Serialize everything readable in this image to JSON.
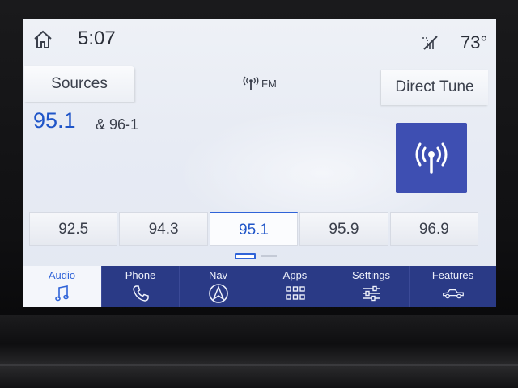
{
  "status": {
    "time": "5:07",
    "temperature": "73°"
  },
  "header": {
    "sources_label": "Sources",
    "band_label": "FM",
    "direct_tune_label": "Direct Tune"
  },
  "now_playing": {
    "frequency": "95.1",
    "station_name": "& 96-1"
  },
  "presets": [
    {
      "label": "92.5",
      "active": false
    },
    {
      "label": "94.3",
      "active": false
    },
    {
      "label": "95.1",
      "active": true
    },
    {
      "label": "95.9",
      "active": false
    },
    {
      "label": "96.9",
      "active": false
    }
  ],
  "pager": {
    "current_page": 1,
    "page_count": 2
  },
  "nav": {
    "audio": "Audio",
    "phone": "Phone",
    "nav": "Nav",
    "apps": "Apps",
    "settings": "Settings",
    "features": "Features"
  },
  "icons": {
    "home": "home-icon",
    "no_signal": "no-signal-icon",
    "antenna": "antenna-icon",
    "music_note": "music-note-icon",
    "phone": "phone-icon",
    "navigation": "navigation-icon",
    "apps_grid": "apps-grid-icon",
    "sliders": "sliders-icon",
    "vehicle": "vehicle-icon"
  },
  "colors": {
    "accent": "#2f63d8",
    "nav_background": "#2a3a86",
    "radio_tile": "#3e4fb2"
  }
}
